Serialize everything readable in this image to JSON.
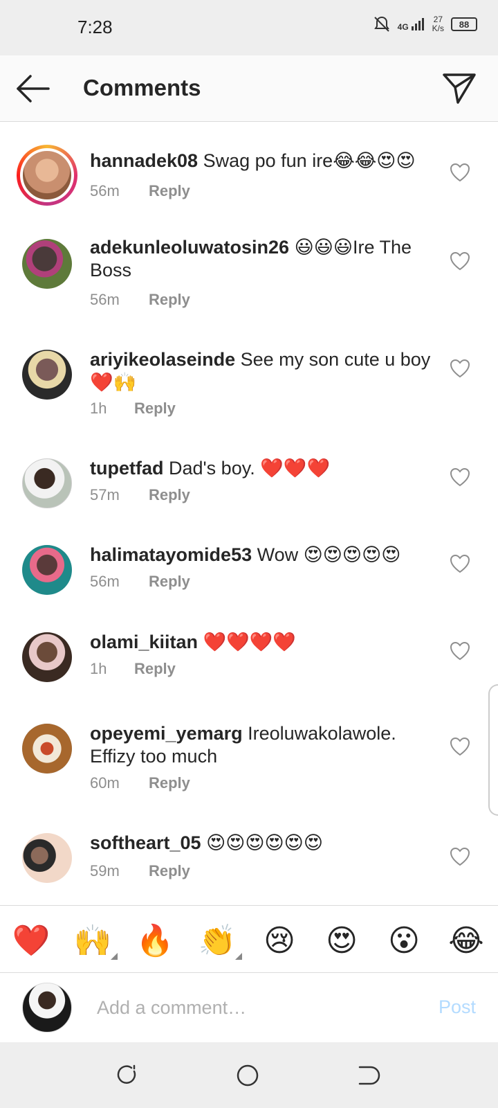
{
  "status_bar": {
    "time": "7:28",
    "network": "4G",
    "speed_value": "27",
    "speed_unit": "K/s",
    "battery": "88"
  },
  "header": {
    "title": "Comments"
  },
  "comments": [
    {
      "username": "hannadek08",
      "text": " Swag po fun ire😂😂😍😍",
      "time": "56m",
      "reply": "Reply",
      "avatar_color": "#c98f6f",
      "story": true
    },
    {
      "username": "adekunleoluwatosin26",
      "text": " 😃😃😃Ire The Boss",
      "time": "56m",
      "reply": "Reply",
      "avatar_color": "#4a3a3a"
    },
    {
      "username": "ariyikeolaseinde",
      "text": " See my son cute u boy ❤️🙌",
      "time": "1h",
      "reply": "Reply",
      "avatar_color": "#7a5a58"
    },
    {
      "username": "tupetfad",
      "text": " Dad's boy. ❤️❤️❤️",
      "time": "57m",
      "reply": "Reply",
      "avatar_color": "#b9c3b8"
    },
    {
      "username": "halimatayomide53",
      "text": " Wow 😍😍😍😍😍",
      "time": "56m",
      "reply": "Reply",
      "avatar_color": "#1f8a8a"
    },
    {
      "username": "olami_kiitan",
      "text": " ❤️❤️❤️❤️",
      "time": "1h",
      "reply": "Reply",
      "avatar_color": "#6b4b3a"
    },
    {
      "username": "opeyemi_yemarg",
      "text": " Ireoluwakolawole. Effizy too much",
      "time": "60m",
      "reply": "Reply",
      "avatar_color": "#a7672d"
    },
    {
      "username": "softheart_05",
      "text": " 😍😍😍😍😍😍",
      "time": "59m",
      "reply": "Reply",
      "avatar_color": "#8c6a5a"
    }
  ],
  "emoji_bar": [
    {
      "emoji": "❤️",
      "name": "red-heart"
    },
    {
      "emoji": "🙌",
      "name": "raising-hands"
    },
    {
      "emoji": "🔥",
      "name": "fire"
    },
    {
      "emoji": "👏",
      "name": "clapping-hands"
    },
    {
      "emoji": "😢",
      "name": "crying-face"
    },
    {
      "emoji": "😍",
      "name": "heart-eyes"
    },
    {
      "emoji": "😮",
      "name": "surprised-face"
    },
    {
      "emoji": "😂",
      "name": "tears-of-joy"
    }
  ],
  "comment_bar": {
    "placeholder": "Add a comment…",
    "post_label": "Post"
  },
  "icons": {
    "back": "arrow-left-icon",
    "share": "paper-plane-icon",
    "like": "heart-outline-icon",
    "nav_recent": "recent-apps-icon",
    "nav_home": "home-circle-icon",
    "nav_back": "nav-back-icon"
  },
  "colors": {
    "post_disabled": "#b3dbff",
    "meta_gray": "#8e8e8e",
    "text": "#262626"
  }
}
